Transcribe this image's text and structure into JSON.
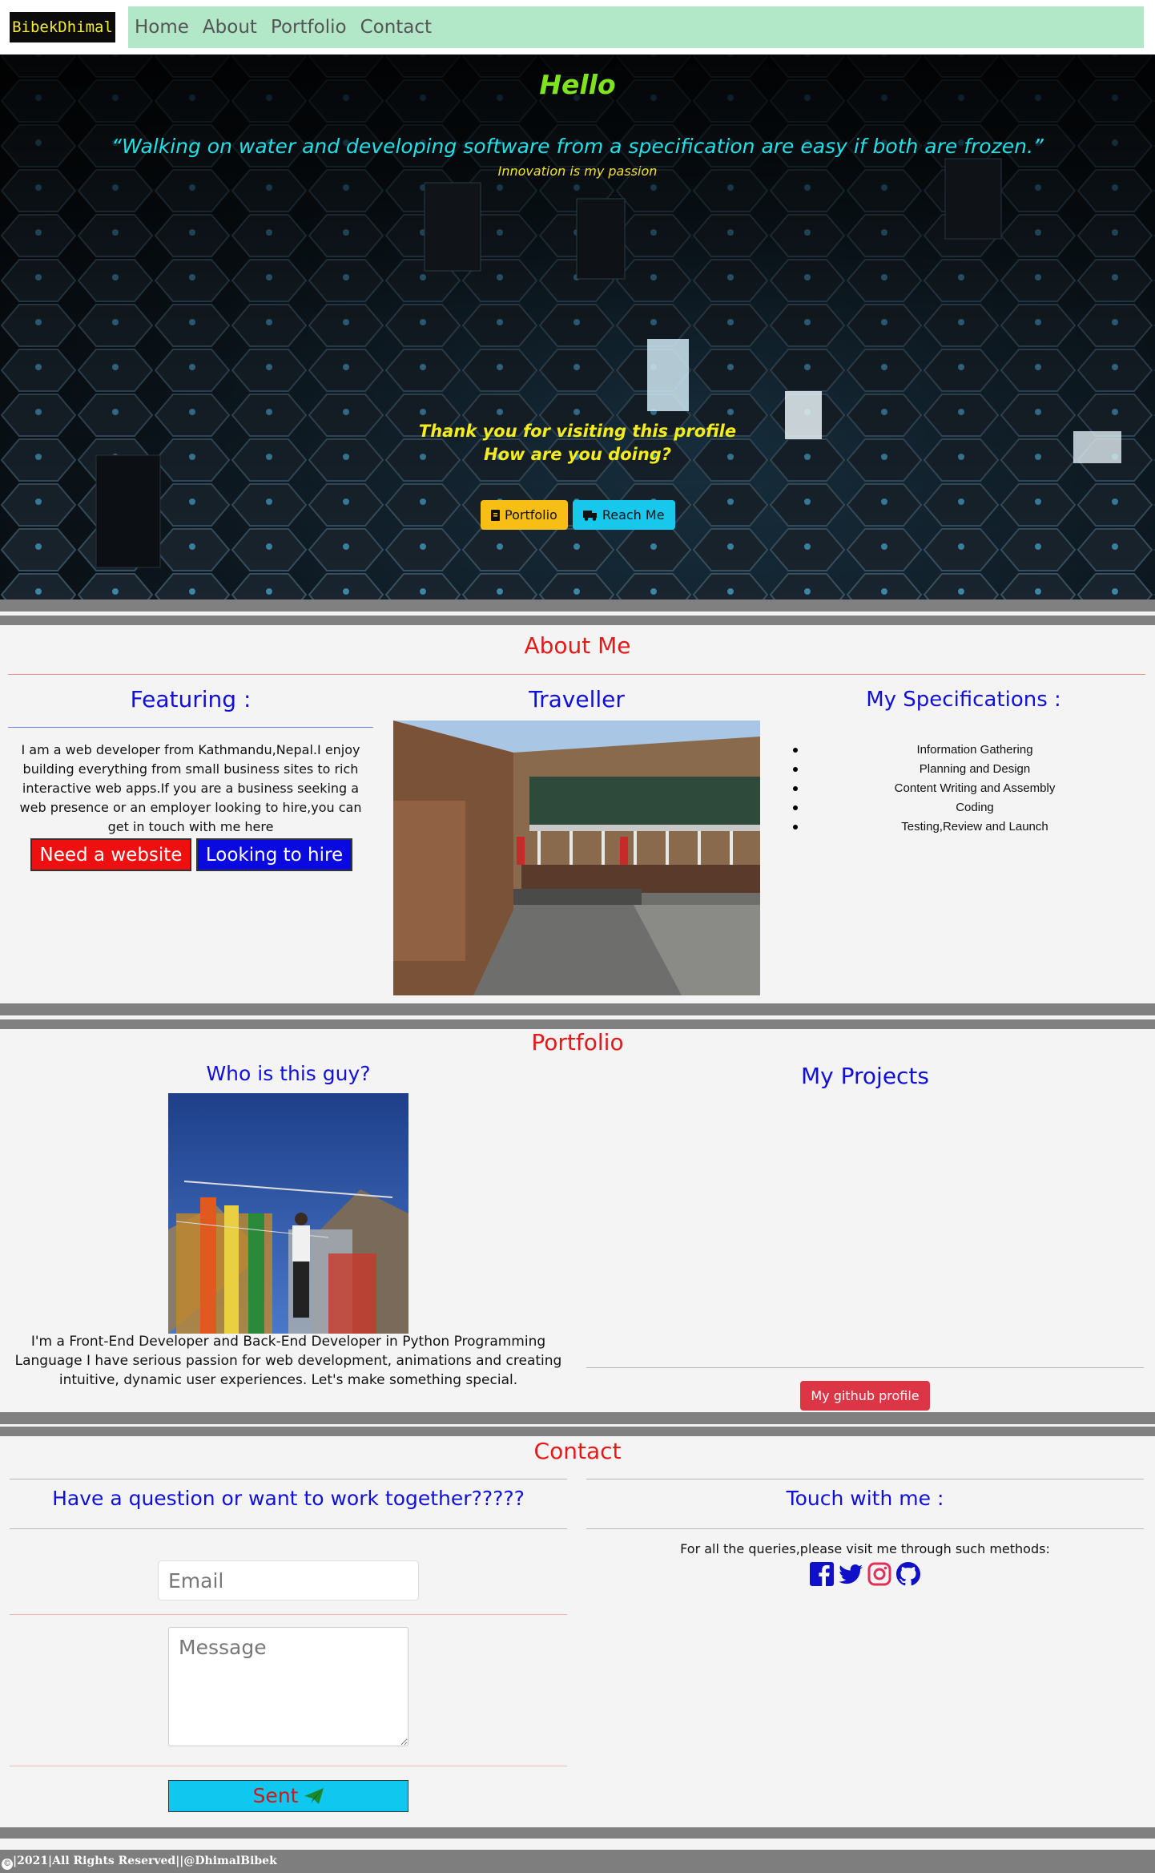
{
  "nav": {
    "brand": "BibekDhimal",
    "links": [
      "Home",
      "About",
      "Portfolio",
      "Contact"
    ]
  },
  "hero": {
    "title": "Hello",
    "quote": "“Walking on water and developing software from a specification are easy if both are frozen.”",
    "tagline": "Innovation is my passion",
    "thanks_line1": "Thank you for visiting this profile",
    "thanks_line2": "How are you doing?",
    "portfolio_button": "Portfolio",
    "reach_button": "Reach Me"
  },
  "about": {
    "title": "About Me",
    "featuring_title": "Featuring :",
    "featuring_text": "I am a web developer from Kathmandu,Nepal.I enjoy building everything from small business sites to rich interactive web apps.If you are a business seeking a web presence or an employer looking to hire,you can get in touch with me here",
    "website_button": "Need a website",
    "hire_button": "Looking to hire",
    "traveller_title": "Traveller",
    "spec_title": "My Specifications :",
    "specs": [
      "Information Gathering",
      "Planning and Design",
      "Content Writing and Assembly",
      "Coding",
      "Testing,Review and Launch"
    ]
  },
  "portfolio": {
    "title": "Portfolio",
    "who_title": "Who is this guy?",
    "who_text": "I'm a Front-End Developer and Back-End Developer in Python Programming Language I have serious passion for web development, animations and creating intuitive, dynamic user experiences. Let's make something special.",
    "projects_title": "My Projects",
    "github_button": "My github profile"
  },
  "contact": {
    "title": "Contact",
    "question": "Have a question or want to work together?????",
    "email_placeholder": "Email",
    "message_placeholder": "Message",
    "sent_button": "Sent",
    "touch_title": "Touch with me :",
    "queries_text": "For all the queries,please visit me through such methods:",
    "social_icons": [
      "facebook-icon",
      "twitter-icon",
      "instagram-icon",
      "github-icon"
    ]
  },
  "footer": {
    "text": "|2021|All Rights Reserved||@DhimalBibek"
  },
  "colors": {
    "nav_bar": "#b2e8c8",
    "section_title": "#e31a1a",
    "column_title": "#1010d8",
    "hero_title": "#7fe31d",
    "hero_quote": "#20e0e8"
  }
}
